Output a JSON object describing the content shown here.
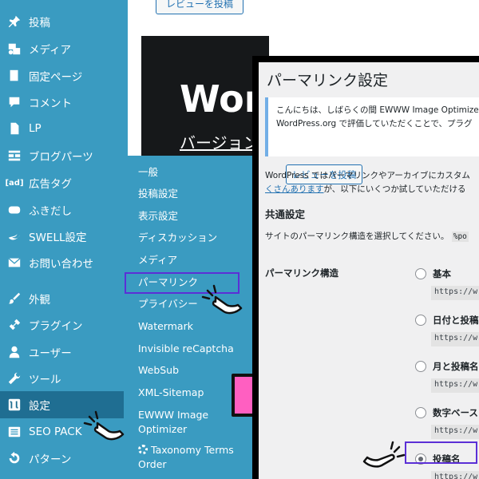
{
  "sidebar": {
    "items": [
      {
        "label": "投稿",
        "icon": "pin-icon"
      },
      {
        "label": "メディア",
        "icon": "media-icon"
      },
      {
        "label": "固定ページ",
        "icon": "page-icon"
      },
      {
        "label": "コメント",
        "icon": "comment-icon"
      },
      {
        "label": "LP",
        "icon": "document-icon"
      },
      {
        "label": "ブログパーツ",
        "icon": "grid-icon"
      },
      {
        "label": "広告タグ",
        "icon_text": "[ad]"
      },
      {
        "label": "ふきだし",
        "icon": "speech-bubble-icon"
      },
      {
        "label": "SWELL設定",
        "icon": "swell-logo-icon"
      },
      {
        "label": "お問い合わせ",
        "icon": "mail-icon"
      },
      {
        "label": "外観",
        "icon": "brush-icon"
      },
      {
        "label": "プラグイン",
        "icon": "plugin-icon"
      },
      {
        "label": "ユーザー",
        "icon": "user-icon"
      },
      {
        "label": "ツール",
        "icon": "wrench-icon"
      },
      {
        "label": "設定",
        "icon": "settings-icon",
        "active": true
      },
      {
        "label": "SEO PACK",
        "icon": "list-icon"
      },
      {
        "label": "パターン",
        "icon": "undo-icon"
      }
    ]
  },
  "background": {
    "review_button": "レビューを投稿",
    "hero_title": "Wor",
    "hero_subtitle": "バージョン"
  },
  "flyout": {
    "items": [
      "一般",
      "投稿設定",
      "表示設定",
      "ディスカッション",
      "メディア",
      "パーマリンク",
      "プライバシー",
      "Watermark",
      "Invisible reCaptcha",
      "WebSub",
      "XML-Sitemap",
      "EWWW Image",
      "Optimizer",
      "Taxonomy Terms",
      "Order"
    ]
  },
  "panel": {
    "title": "パーマリンク設定",
    "notice_line1": "こんにちは、しばらくの間 EWWW Image Optimize",
    "notice_line2": "WordPress.org で評価していただくことで、プラグ",
    "notice_button": "レビューを投稿",
    "intro_line1": "WordPress ではパーマリンクやアーカイブにカスタム",
    "intro_link": "くさんあります",
    "intro_line2_rest": "が、以下にいくつか試していただける",
    "common_heading": "共通設定",
    "common_desc": "サイトのパーマリンク構造を選択してください。",
    "common_code": "%po",
    "structure_label": "パーマリンク構造",
    "options": [
      {
        "label": "基本",
        "code": "https://w"
      },
      {
        "label": "日付と投稿",
        "code": "https://w"
      },
      {
        "label": "月と投稿名",
        "code": "https://w"
      },
      {
        "label": "数字ベース",
        "code": "https://w"
      },
      {
        "label": "投稿名",
        "code": "https://w",
        "selected": true
      }
    ]
  },
  "colors": {
    "sidebar_bg": "#3a9bc1",
    "active_bg": "#1f6e92",
    "highlight": "#5b2fd6",
    "arrow": "#ff5fc1",
    "link": "#2271b1"
  }
}
